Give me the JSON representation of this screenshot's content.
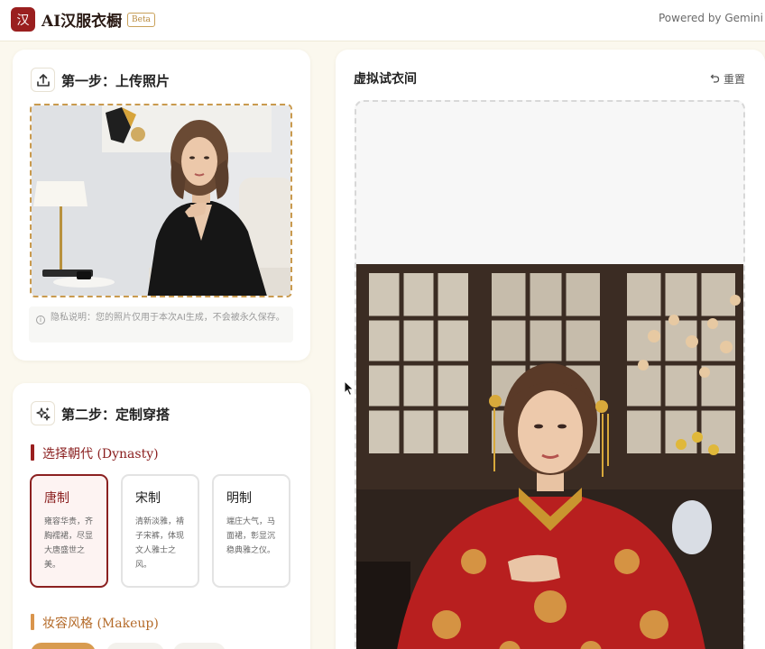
{
  "header": {
    "logo_char": "汉",
    "title": "AI汉服衣橱",
    "badge": "Beta",
    "powered_by": "Powered by Gemini"
  },
  "step1": {
    "icon": "upload-icon",
    "title": "第一步：上传照片",
    "privacy_note": "隐私说明：您的照片仅用于本次AI生成，不会被永久保存。"
  },
  "step2": {
    "icon": "sparkle-icon",
    "title": "第二步：定制穿搭",
    "dynasty_label": "选择朝代 (Dynasty)",
    "dynasties": [
      {
        "name": "唐制",
        "desc": "雍容华贵，齐胸襦裙，尽显大唐盛世之美。",
        "selected": true
      },
      {
        "name": "宋制",
        "desc": "清新淡雅，褙子宋裤，体现文人雅士之风。",
        "selected": false
      },
      {
        "name": "明制",
        "desc": "端庄大气，马面裙，彰显沉稳典雅之仪。",
        "selected": false
      }
    ],
    "makeup_label": "妆容风格 (Makeup)"
  },
  "tryon": {
    "title": "虚拟试衣间",
    "reset_label": "重置",
    "reset_icon": "undo-icon"
  },
  "colors": {
    "brand_red": "#9a1f1f",
    "accent_gold": "#c99a4e",
    "background": "#fbf8ee"
  }
}
